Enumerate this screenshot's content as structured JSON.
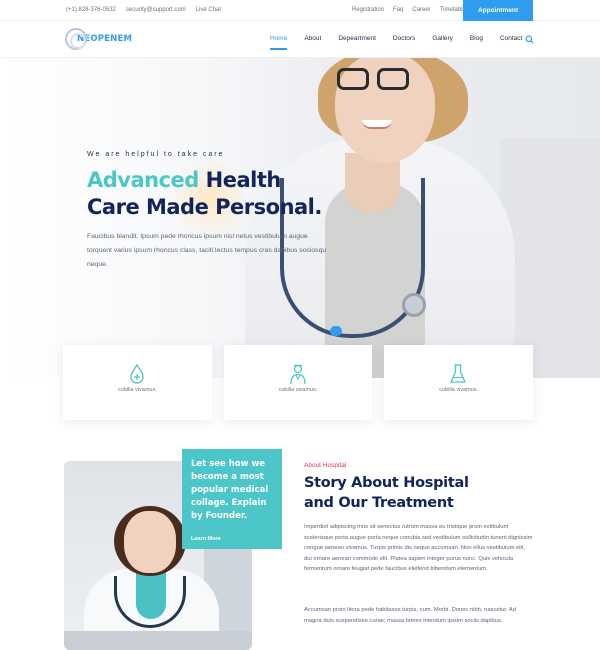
{
  "colors": {
    "accent_blue": "#2d9df0",
    "accent_teal": "#4dc6c9",
    "navy": "#12245a",
    "kicker_red": "#e0345c"
  },
  "topbar": {
    "phone": "(+1) 828-376-0532",
    "email": "security@support.com",
    "chat": "Live Chat",
    "links": [
      "Registration",
      "Faq",
      "Career",
      "Timetable"
    ],
    "appointment": "Appointment"
  },
  "nav": {
    "logo": "NEOPENEM",
    "items": [
      "Home",
      "About",
      "Depeartment",
      "Doctors",
      "Gallery",
      "Blog",
      "Contact"
    ],
    "active_index": 0,
    "search_icon": "search-icon"
  },
  "hero": {
    "tagline": "We are helpful to take care",
    "title_accent": "Advanced",
    "title_rest_line1": " Health",
    "title_line2": "Care Made Personal.",
    "description": "Faucibus blandit. Ipsum pede rhoncus ipsum nisl netus vestibulum augue torquent varius ipsum rhoncus class, taciti lectus tempus cras dapibus sociosqu neque."
  },
  "features": [
    {
      "icon": "drop-medical-icon",
      "label": "cubilia vivamus."
    },
    {
      "icon": "doctor-icon",
      "label": "cubilia vivamus."
    },
    {
      "icon": "flask-icon",
      "label": "cubilia vivamus."
    }
  ],
  "about": {
    "quote": "Let see how we become a most popular medical collage. Explain by Founder.",
    "learn_more": "Learn More",
    "kicker": "About Hospital",
    "title_line1": "Story About Hospital",
    "title_line2": "and Our Treatment",
    "para1": "Imperdiet adipiscing mus sit senectus rutrum massa eu tristique proin estibulum scelerisque porta augue porta neque conubia sed vestibulum sollicitudin tunent dignissim congue aenean vivamus. Turpis primis dis neque accumsan. Non ellus vestibulum elit, dui ornare aenean commodo elit. Platea sapien integer purus nunc. Quis vehicula fermentum ornare feugiat pede faucibus eleifend bibendum elementum.",
    "para2": "Accumsan proin litora pede habitasse turpis, cum. Morbi. Donec nibh, nascetur. Ad magna duis suspendisse curae; massa fames interdum ipsum sociis dapibus."
  }
}
